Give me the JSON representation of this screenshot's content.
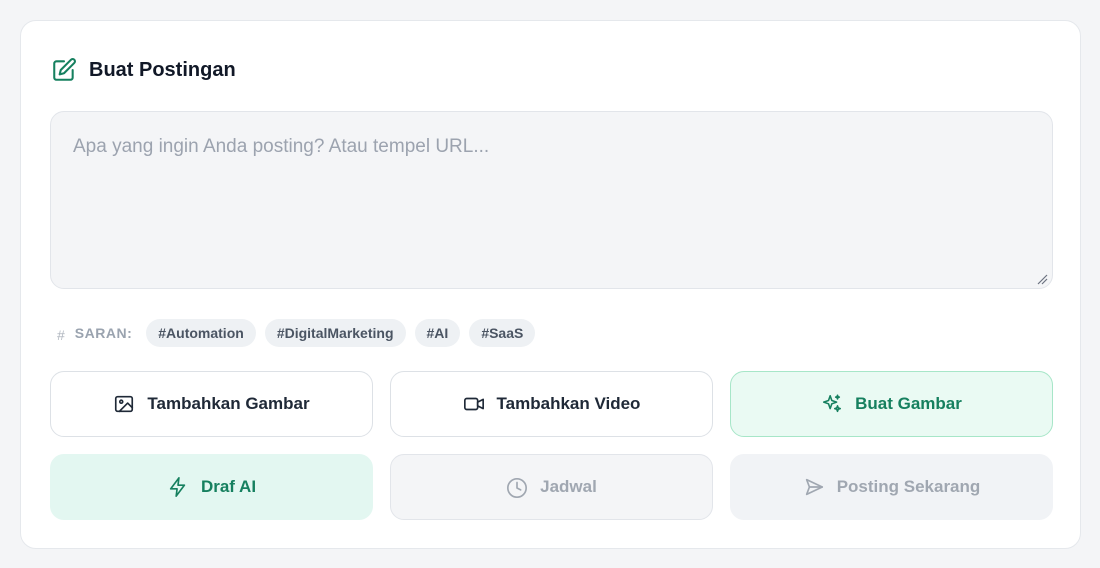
{
  "header": {
    "title": "Buat Postingan",
    "icon": "edit-icon"
  },
  "composer": {
    "placeholder": "Apa yang ingin Anda posting? Atau tempel URL...",
    "value": ""
  },
  "suggestions": {
    "label": "SARAN:",
    "tags": [
      "#Automation",
      "#DigitalMarketing",
      "#AI",
      "#SaaS"
    ]
  },
  "actions": {
    "add_image": "Tambahkan Gambar",
    "add_video": "Tambahkan Video",
    "generate_image": "Buat Gambar",
    "ai_draft": "Draf AI",
    "schedule": "Jadwal",
    "post_now": "Posting Sekarang"
  },
  "colors": {
    "accent": "#16805f",
    "mint_bg": "#eafaf3",
    "disabled_text": "#a0a7b1"
  }
}
